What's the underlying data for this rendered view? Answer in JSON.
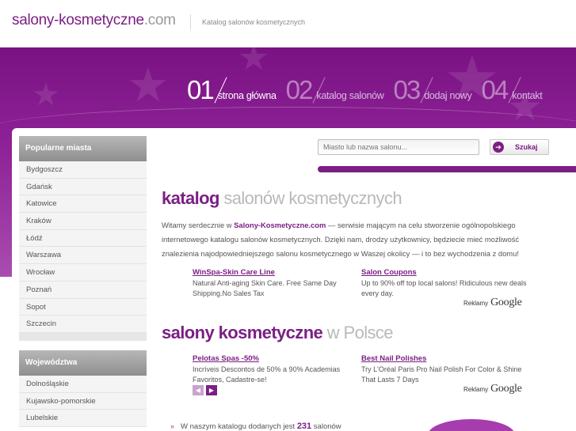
{
  "header": {
    "logo_main": "salony-kosmetyczne",
    "logo_tld": ".com",
    "tagline": "Katalog salonów kosmetycznych"
  },
  "nav": [
    {
      "num": "01",
      "label": "strona główna",
      "active": true
    },
    {
      "num": "02",
      "label": "katalog salonów",
      "active": false
    },
    {
      "num": "03",
      "label": "dodaj nowy",
      "active": false
    },
    {
      "num": "04",
      "label": "kontakt",
      "active": false
    }
  ],
  "sidebar": {
    "cities_title": "Popularne miasta",
    "cities": [
      "Bydgoszcz",
      "Gdańsk",
      "Katowice",
      "Kraków",
      "Łódź",
      "Warszawa",
      "Wrocław",
      "Poznań",
      "Sopot",
      "Szczecin"
    ],
    "regions_title": "Województwa",
    "regions": [
      "Dolnośląskie",
      "Kujawsko-pomorskie",
      "Lubelskie"
    ]
  },
  "search": {
    "placeholder": "Miasto lub nazwa salonu...",
    "button_label": "Szukaj"
  },
  "main": {
    "heading1_bold": "katalog",
    "heading1_rest": " salonów kosmetycznych",
    "intro_pre": "Witamy serdecznie w ",
    "intro_site": "Salony-Kosmetyczne.com",
    "intro_post": " — serwisie mającym na celu stworzenie ogólnopolskiego internetowego katalogu salonów kosmetycznych. Dzięki nam, drodzy użytkownicy, będziecie mieć możliwość znalezienia najodpowiedniejszego salonu kosmetycznego w Waszej okolicy — i to bez wychodzenia z domu!",
    "heading2_bold": "salony kosmetyczne",
    "heading2_rest": " w Polsce",
    "stat_pre": "W naszym katalogu dodanych jest ",
    "stat_count": "231",
    "stat_post": " salonów"
  },
  "ads_top": [
    {
      "title": "WinSpa-Skin Care Line",
      "text": "Natural Anti-aging Skin Care. Free Same Day Shipping.No Sales Tax"
    },
    {
      "title": "Salon Coupons",
      "text": "Up to 90% off top local salons! Ridiculous new deals every day."
    }
  ],
  "ads_bottom": [
    {
      "title": "Pelotas Spas -50%",
      "text": "Incríveis Descontos de 50% a 90% Academias Favoritos, Cadastre-se!"
    },
    {
      "title": "Best Nail Polishes",
      "text": "Try L'Oréal Paris Pro Nail Polish For Color & Shine That Lasts 7 Days"
    }
  ],
  "ads_label": {
    "reklamy": "Reklamy",
    "google": "Google"
  },
  "colors": {
    "brand": "#7b1f84",
    "band": "#8e2397",
    "bullet": "#c8366a"
  },
  "icons": {
    "search": "search-arrow-icon",
    "prev": "chevron-left-icon",
    "next": "chevron-right-icon"
  }
}
